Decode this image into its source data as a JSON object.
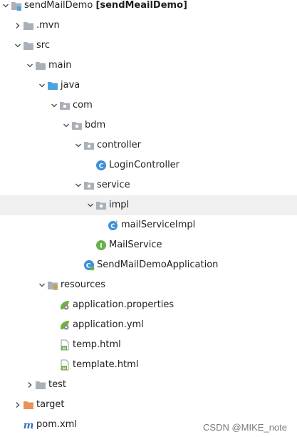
{
  "tree": [
    {
      "label": "sendMailDemo",
      "bold_suffix": "[sendMeailDemo]",
      "icon": "project-folder-icon",
      "arrow": "down",
      "depth": 0
    },
    {
      "label": ".mvn",
      "icon": "folder-icon",
      "arrow": "right",
      "depth": 1
    },
    {
      "label": "src",
      "icon": "folder-icon",
      "arrow": "down",
      "depth": 1
    },
    {
      "label": "main",
      "icon": "folder-icon",
      "arrow": "down",
      "depth": 2
    },
    {
      "label": "java",
      "icon": "source-folder-icon",
      "arrow": "down",
      "depth": 3
    },
    {
      "label": "com",
      "icon": "package-icon",
      "arrow": "down",
      "depth": 4
    },
    {
      "label": "bdm",
      "icon": "package-icon",
      "arrow": "down",
      "depth": 5
    },
    {
      "label": "controller",
      "icon": "package-icon",
      "arrow": "down",
      "depth": 6
    },
    {
      "label": "LoginController",
      "icon": "class-icon",
      "arrow": "none",
      "depth": 7
    },
    {
      "label": "service",
      "icon": "package-icon",
      "arrow": "down",
      "depth": 6
    },
    {
      "label": "impl",
      "icon": "package-icon",
      "arrow": "down",
      "depth": 7,
      "selected": true
    },
    {
      "label": "mailServiceImpl",
      "icon": "class-impl-icon",
      "arrow": "none",
      "depth": 8
    },
    {
      "label": "MailService",
      "icon": "interface-icon",
      "arrow": "none",
      "depth": 7
    },
    {
      "label": "SendMailDemoApplication",
      "icon": "spring-app-class-icon",
      "arrow": "none",
      "depth": 6
    },
    {
      "label": "resources",
      "icon": "resources-folder-icon",
      "arrow": "down",
      "depth": 3
    },
    {
      "label": "application.properties",
      "icon": "spring-config-icon",
      "arrow": "none",
      "depth": 4
    },
    {
      "label": "application.yml",
      "icon": "spring-config-icon",
      "arrow": "none",
      "depth": 4
    },
    {
      "label": "temp.html",
      "icon": "html-file-icon",
      "arrow": "none",
      "depth": 4
    },
    {
      "label": "template.html",
      "icon": "html-file-icon",
      "arrow": "none",
      "depth": 4
    },
    {
      "label": "test",
      "icon": "folder-icon",
      "arrow": "right",
      "depth": 2
    },
    {
      "label": "target",
      "icon": "target-folder-icon",
      "arrow": "right",
      "depth": 1
    },
    {
      "label": "pom.xml",
      "icon": "maven-icon",
      "arrow": "none",
      "depth": 1
    }
  ],
  "watermark": "CSDN @MIKE_note",
  "colors": {
    "folder": "#aab0b8",
    "source": "#4aa3df",
    "orange": "#e8935a",
    "class": "#3d8fd9",
    "interface": "#6ab04c",
    "spring": "#6db33f",
    "maven": "#3c6fb6",
    "selected": "#f0f0f0"
  }
}
